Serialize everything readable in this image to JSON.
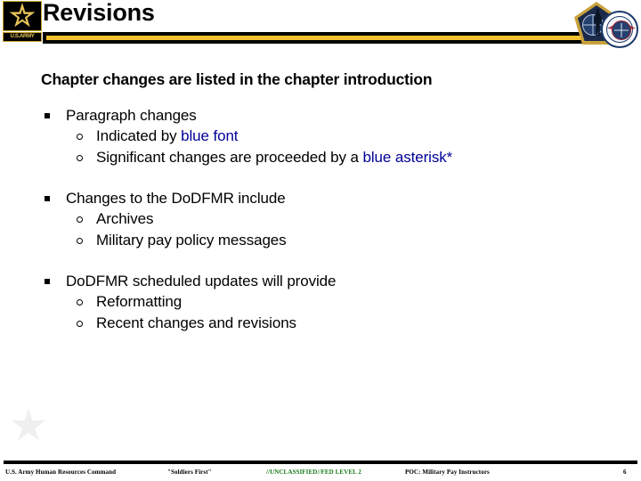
{
  "header": {
    "title": "Revisions",
    "logo_label": "U.S.ARMY",
    "logo_icon": "army-star-logo",
    "emblem_icon": "hrc-pentagon-emblem",
    "seal_icon": "dod-round-seal"
  },
  "content": {
    "lead": "Chapter changes are listed in the chapter introduction",
    "groups": [
      {
        "heading": "Paragraph changes",
        "subitems": [
          {
            "prefix": "Indicated by ",
            "highlight": "blue font",
            "suffix": ""
          },
          {
            "prefix": "Significant changes are proceeded by a ",
            "highlight": "blue asterisk*",
            "suffix": ""
          }
        ]
      },
      {
        "heading": "Changes to the DoDFMR include",
        "subitems": [
          {
            "prefix": "Archives",
            "highlight": "",
            "suffix": ""
          },
          {
            "prefix": "Military pay policy messages",
            "highlight": "",
            "suffix": ""
          }
        ]
      },
      {
        "heading": "DoDFMR scheduled updates will provide",
        "subitems": [
          {
            "prefix": "Reformatting",
            "highlight": "",
            "suffix": ""
          },
          {
            "prefix": "Recent changes and revisions",
            "highlight": "",
            "suffix": ""
          }
        ]
      }
    ]
  },
  "footer": {
    "org": "U.S. Army Human Resources Command",
    "motto": "\"Soldiers First\"",
    "classification": "//UNCLASSIFIED//FED LEVEL 2",
    "poc": "POC: Military Pay Instructors",
    "page": "6"
  },
  "colors": {
    "gold": "#f2c12e",
    "blue_text": "#000099",
    "classification_green": "#1a7a1a",
    "black": "#000000"
  }
}
